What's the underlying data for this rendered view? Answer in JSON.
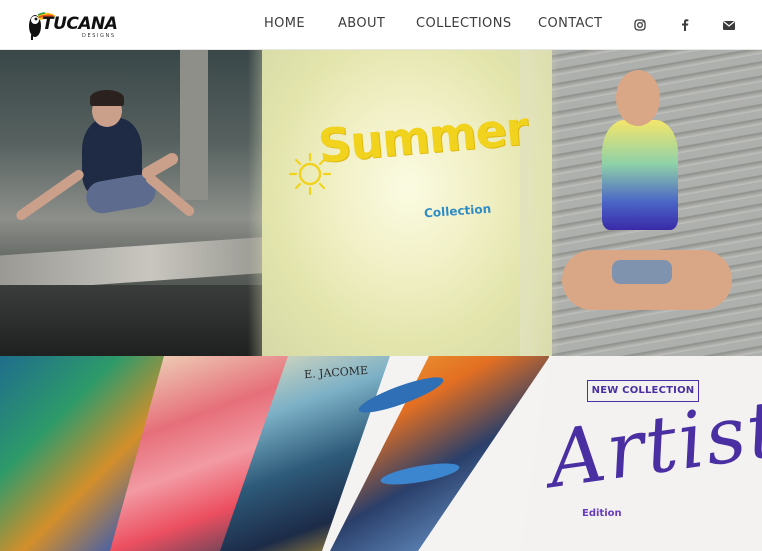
{
  "header": {
    "logo": {
      "name": "TUCANA",
      "tagline": "DESIGNS"
    },
    "nav": [
      {
        "label": "HOME"
      },
      {
        "label": "ABOUT"
      },
      {
        "label": "COLLECTIONS"
      },
      {
        "label": "CONTACT"
      }
    ],
    "social_icons": [
      "instagram-icon",
      "facebook-icon",
      "envelope-icon"
    ]
  },
  "banners": {
    "summer": {
      "title": "Summer",
      "subtitle": "Collection"
    },
    "artist": {
      "badge": "NEW COLLECTION",
      "title": "Artist",
      "subtitle": "Edition",
      "signature": "E. JACOME"
    }
  },
  "colors": {
    "nav_text": "#3c3c3c",
    "summer_yellow": "#f1d21d",
    "summer_blue": "#2f8bc4",
    "artist_purple": "#4a2fa3"
  }
}
